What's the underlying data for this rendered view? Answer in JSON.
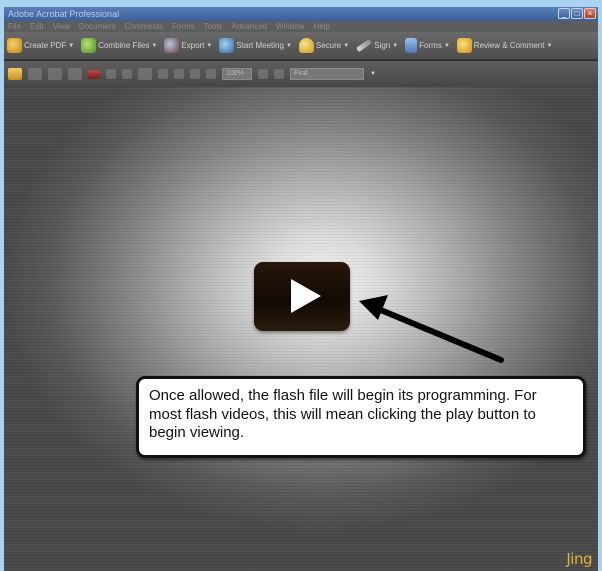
{
  "window": {
    "title": "Adobe Acrobat Professional",
    "controls": [
      "minimize-icon",
      "maximize-icon",
      "close-icon"
    ]
  },
  "menubar": {
    "items": [
      "File",
      "Edit",
      "View",
      "Document",
      "Comments",
      "Forms",
      "Tools",
      "Advanced",
      "Window",
      "Help"
    ]
  },
  "toolbar": {
    "create_pdf": "Create PDF",
    "combine_files": "Combine Files",
    "export": "Export",
    "start_meeting": "Start Meeting",
    "secure": "Secure",
    "sign": "Sign",
    "forms": "Forms",
    "review_comment": "Review & Comment"
  },
  "toolbar2": {
    "zoom": "100%",
    "find_placeholder": "Find"
  },
  "content": {
    "play_icon": "play-icon",
    "callout_text": "Once allowed, the flash file will begin its programming. For most flash videos, this will mean clicking the play button to begin viewing.",
    "watermark": "Jing"
  },
  "colors": {
    "desktop": "#a9d3ef",
    "titlebar": "#4a6fa8",
    "watermark": "#e2b23a"
  }
}
